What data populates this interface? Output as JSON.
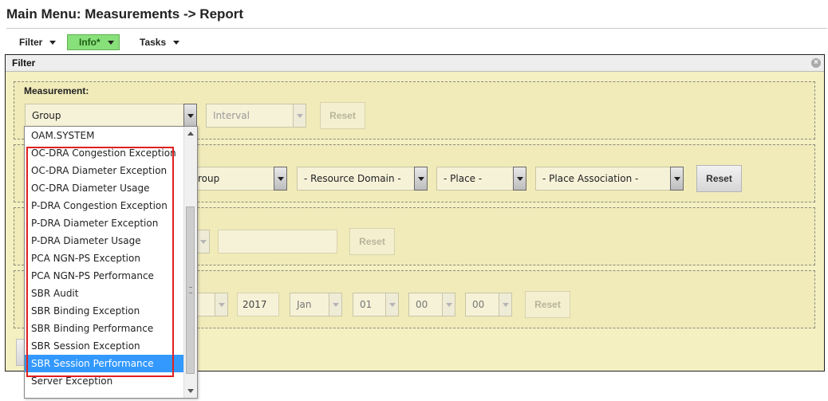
{
  "page": {
    "title": "Main Menu: Measurements -> Report"
  },
  "menubar": {
    "items": [
      {
        "label": "Filter"
      },
      {
        "label": "Info*"
      },
      {
        "label": "Tasks"
      }
    ]
  },
  "panel": {
    "title": "Filter",
    "close_icon": "circle-x-icon",
    "measurement": {
      "label": "Measurement:",
      "group_value": "Group",
      "interval_placeholder": "Interval",
      "reset_label": "Reset"
    },
    "scope": {
      "group_partial_value": "roup",
      "resource_domain_value": "- Resource Domain -",
      "place_value": "- Place -",
      "place_association_value": "- Place Association -",
      "reset_label": "Reset"
    },
    "row3": {
      "reset_label": "Reset"
    },
    "time": {
      "year": "2017",
      "month": "Jan",
      "day": "01",
      "hour": "00",
      "minute": "00",
      "reset_label": "Reset"
    }
  },
  "dropdown": {
    "items": [
      "OAM.SYSTEM",
      "OC-DRA Congestion Exception",
      "OC-DRA Diameter Exception",
      "OC-DRA Diameter Usage",
      "P-DRA Congestion Exception",
      "P-DRA Diameter Exception",
      "P-DRA Diameter Usage",
      "PCA NGN-PS Exception",
      "PCA NGN-PS Performance",
      "SBR Audit",
      "SBR Binding Exception",
      "SBR Binding Performance",
      "SBR Session Exception",
      "SBR Session Performance",
      "Server Exception"
    ],
    "selected_index": 13
  },
  "colors": {
    "panel_bg": "#f5f0c2",
    "info_tab": "#88e07a",
    "selected": "#3399ff",
    "highlight": "#e02020"
  }
}
